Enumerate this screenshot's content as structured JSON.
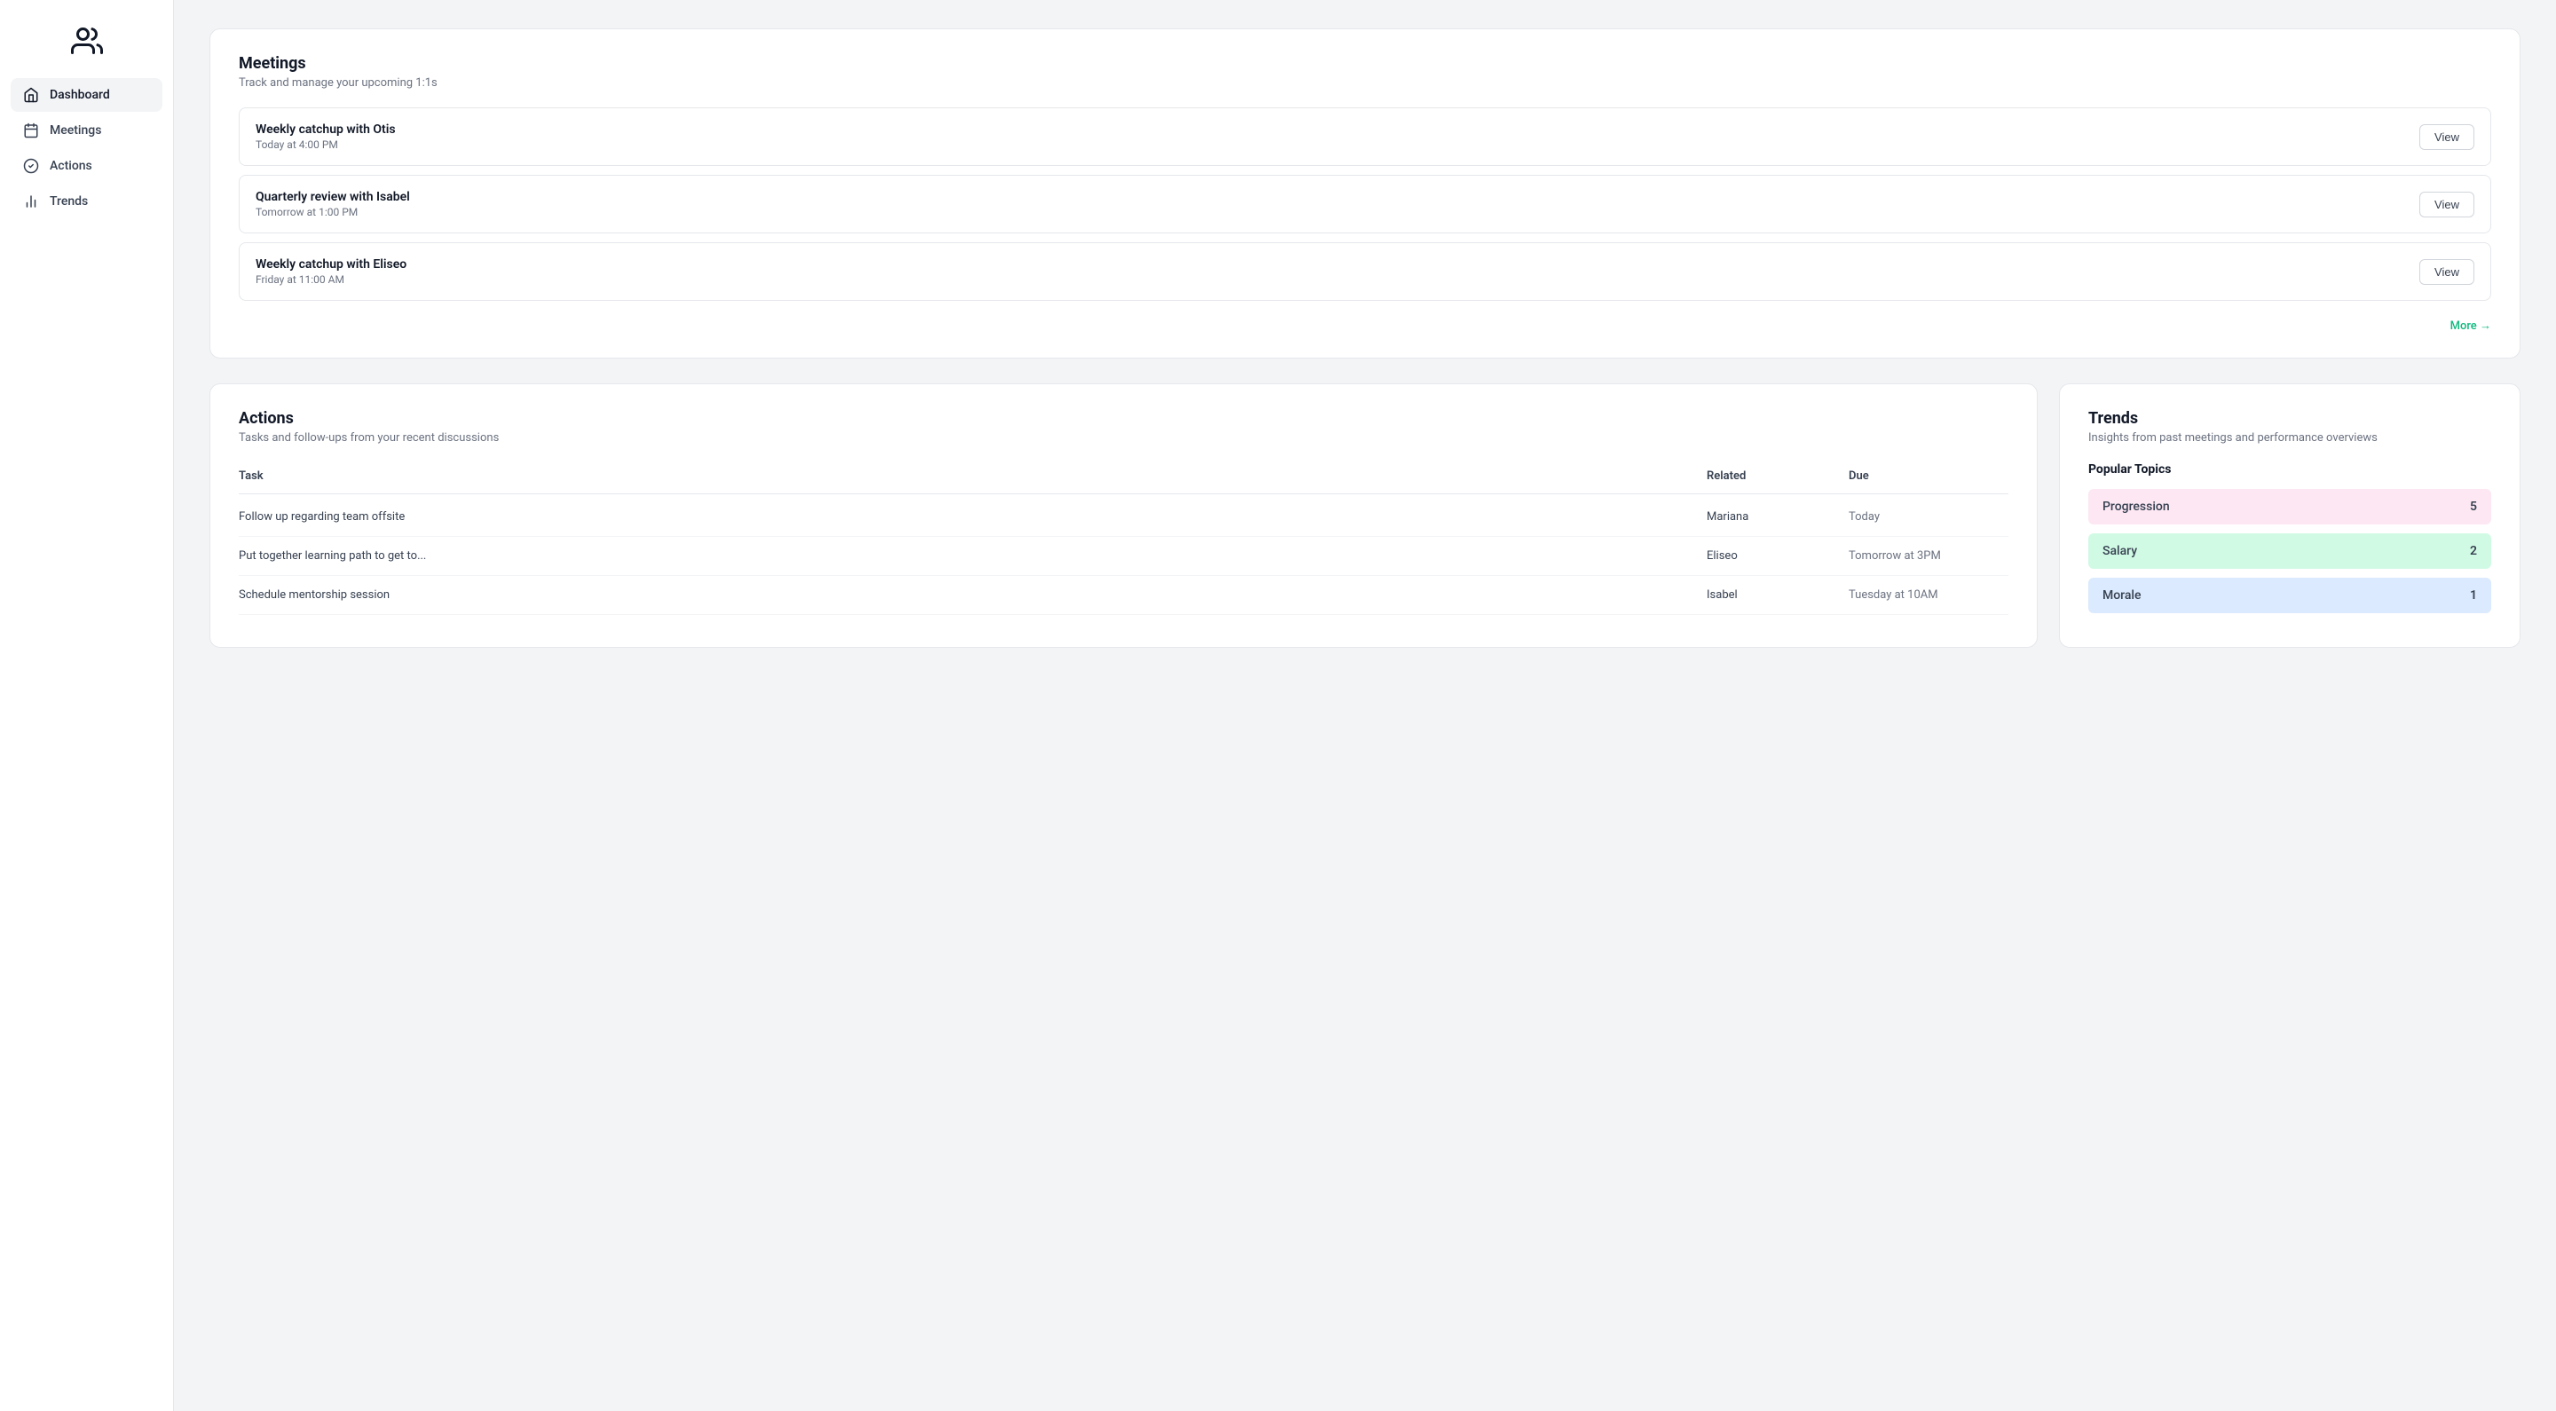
{
  "sidebar": {
    "logo_icon": "people-icon",
    "items": [
      {
        "label": "Dashboard",
        "icon": "home-icon",
        "active": true
      },
      {
        "label": "Meetings",
        "icon": "calendar-icon",
        "active": false
      },
      {
        "label": "Actions",
        "icon": "check-circle-icon",
        "active": false
      },
      {
        "label": "Trends",
        "icon": "bar-chart-icon",
        "active": false
      }
    ]
  },
  "meetings": {
    "title": "Meetings",
    "subtitle": "Track and manage your upcoming 1:1s",
    "items": [
      {
        "name": "Weekly catchup with Otis",
        "time": "Today at 4:00 PM"
      },
      {
        "name": "Quarterly review with Isabel",
        "time": "Tomorrow at 1:00 PM"
      },
      {
        "name": "Weekly catchup with Eliseo",
        "time": "Friday at 11:00 AM"
      }
    ],
    "view_button_label": "View",
    "more_label": "More →"
  },
  "actions": {
    "title": "Actions",
    "subtitle": "Tasks and follow-ups from your recent discussions",
    "table": {
      "headers": [
        "Task",
        "Related",
        "Due"
      ],
      "rows": [
        {
          "task": "Follow up regarding team offsite",
          "related": "Mariana",
          "due": "Today"
        },
        {
          "task": "Put together learning path to get to...",
          "related": "Eliseo",
          "due": "Tomorrow at 3PM"
        },
        {
          "task": "Schedule mentorship session",
          "related": "Isabel",
          "due": "Tuesday at 10AM"
        }
      ]
    }
  },
  "trends": {
    "title": "Trends",
    "subtitle": "Insights from past meetings and performance overviews",
    "popular_topics_label": "Popular Topics",
    "topics": [
      {
        "name": "Progression",
        "count": 5,
        "color": "pink"
      },
      {
        "name": "Salary",
        "count": 2,
        "color": "green"
      },
      {
        "name": "Morale",
        "count": 1,
        "color": "blue"
      }
    ]
  }
}
